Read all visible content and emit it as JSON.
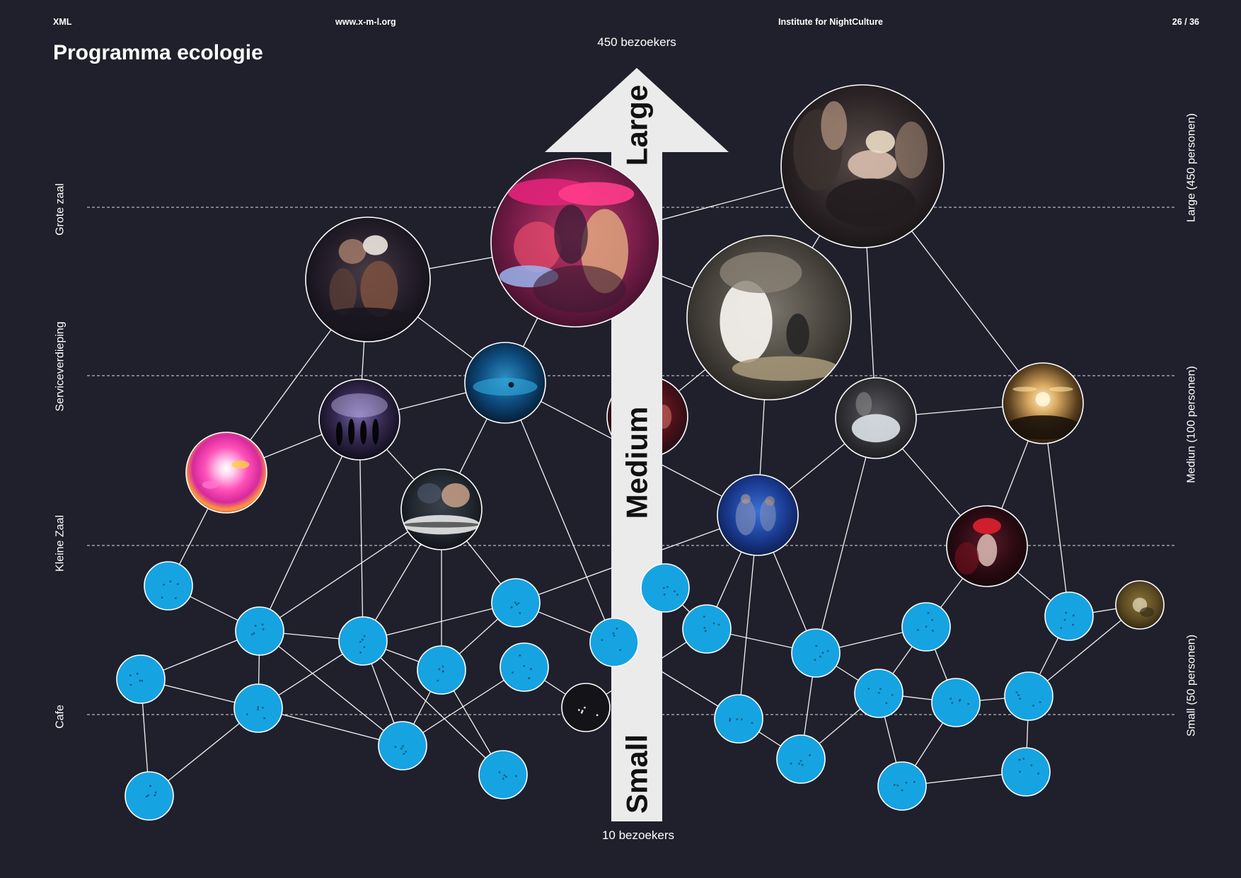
{
  "header": {
    "brand": "XML",
    "website": "www.x-m-l.org",
    "organization": "Institute for NightCulture",
    "page": "26 / 36"
  },
  "title": "Programma ecologie",
  "venue_levels": {
    "grote_zaal": "Grote zaal",
    "serviceverdieping": "Serviceverdieping",
    "kleine_zaal": "Kleine Zaal",
    "cafe": "Cafe"
  },
  "capacities": {
    "large": "Large (450 personen)",
    "medium": "Mediun (100 personen)",
    "small": "Small (50 personen)"
  },
  "scale_arrow": {
    "top_label": "450 bezoekers",
    "bottom_label": "10 bezoekers",
    "large": "Large",
    "medium": "Medium",
    "small": "Small"
  },
  "colors": {
    "background": "#20202c",
    "event_node": "#16a3e2",
    "dark_node": "#141418",
    "arrow": "#ebebeb",
    "line": "#ffffff",
    "text": "#ffffff"
  }
}
